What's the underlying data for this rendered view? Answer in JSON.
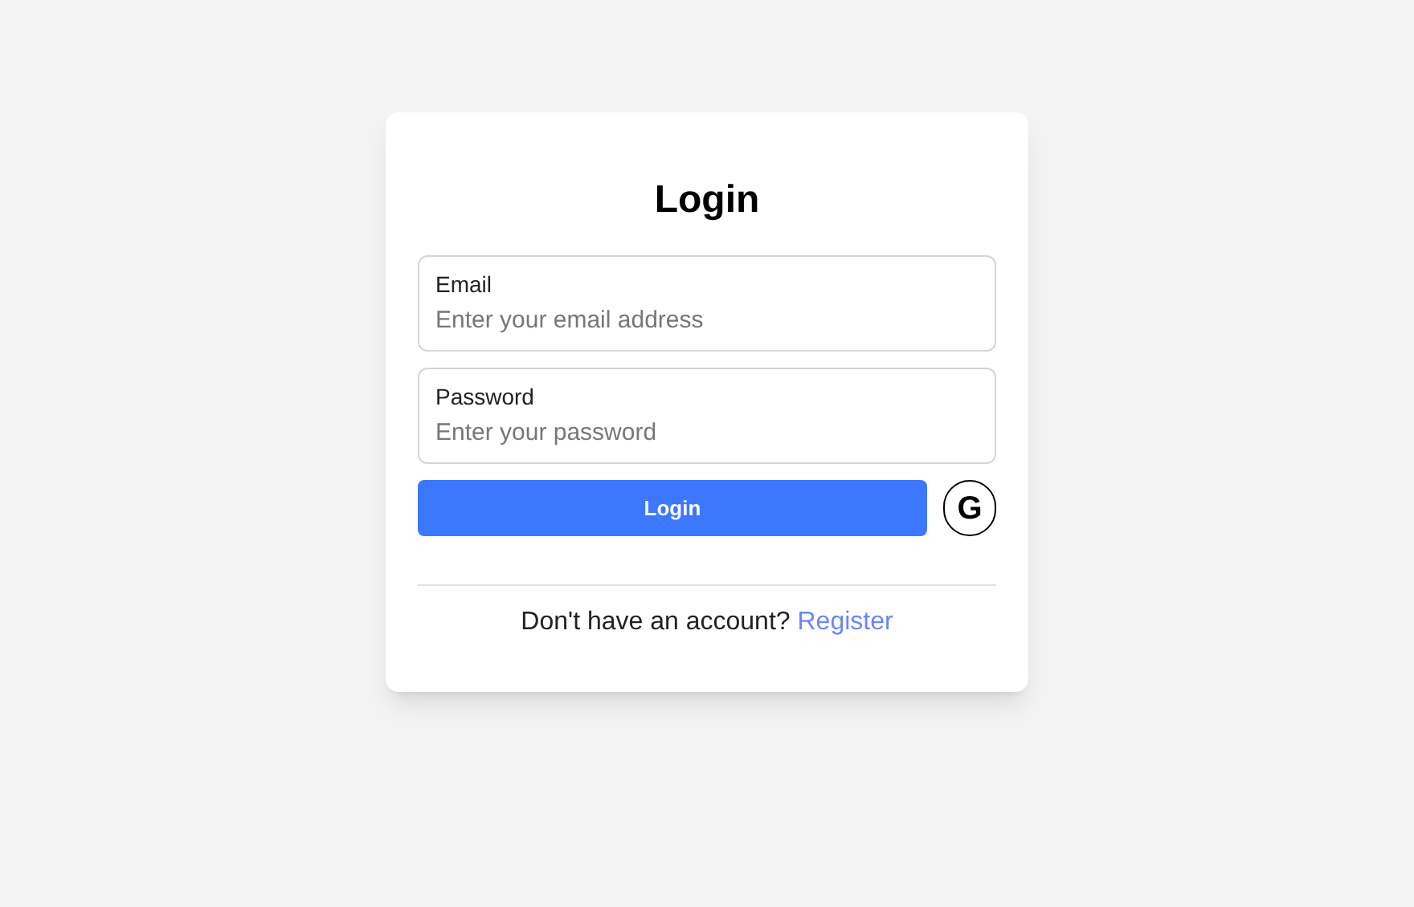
{
  "title": "Login",
  "fields": [
    {
      "label": "Email",
      "placeholder": "Enter your email address"
    },
    {
      "label": "Password",
      "placeholder": "Enter your password"
    }
  ],
  "login_button": "Login",
  "google_button": {
    "label": "G"
  },
  "footer": {
    "text": "Don't have an account?",
    "link": "Register"
  }
}
